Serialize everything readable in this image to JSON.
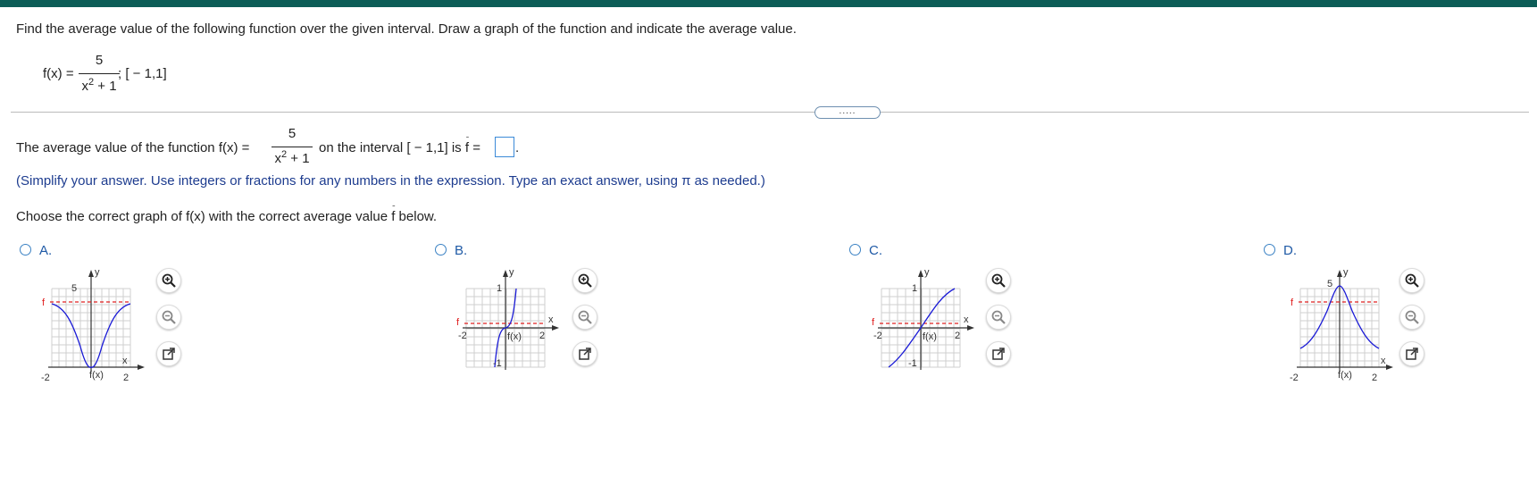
{
  "question": {
    "prompt": "Find the average value of the following function over the given interval. Draw a graph of the function and indicate the average value.",
    "function_lhs": "f(x) =",
    "function_numerator": "5",
    "function_denominator": "x",
    "denominator_exponent": "2",
    "denominator_tail": " + 1",
    "interval": "; [ − 1,1]"
  },
  "more_button": ".....",
  "answer": {
    "lead": "The average value of the function f(x) =",
    "numerator": "5",
    "denominator": "x",
    "exponent": "2",
    "denominator_tail": " + 1",
    "trail": "on the interval [ − 1,1] is",
    "fbar_eq": "f =",
    "end": ".",
    "input_value": ""
  },
  "instruction": "(Simplify your answer. Use integers or fractions for any numbers in the expression. Type an exact answer, using π as needed.)",
  "choose_prompt_a": "Choose the correct graph of f(x) with the correct average value",
  "choose_prompt_b": "f below.",
  "options": [
    {
      "label": "A.",
      "xmin_label": "-2",
      "xmax_label": "2",
      "ytick_label": "5",
      "fn_label": "f(x)",
      "avg_label": "f",
      "x_label": "x",
      "y_label": "y"
    },
    {
      "label": "B.",
      "xmin_label": "-2",
      "xmax_label": "2",
      "ytick_top": "1",
      "ytick_bottom": "-1",
      "fn_label": "f(x)",
      "avg_label": "f",
      "x_label": "x",
      "y_label": "y"
    },
    {
      "label": "C.",
      "xmin_label": "-2",
      "xmax_label": "2",
      "ytick_top": "1",
      "ytick_bottom": "-1",
      "fn_label": "f(x)",
      "avg_label": "f",
      "x_label": "x",
      "y_label": "y"
    },
    {
      "label": "D.",
      "xmin_label": "-2",
      "xmax_label": "2",
      "ytick_label": "5",
      "fn_label": "f(x)",
      "avg_label": "f",
      "x_label": "x",
      "y_label": "y"
    }
  ],
  "colors": {
    "curve": "#1a1ad6",
    "average_line": "#e02020",
    "accent": "#0c5d57",
    "option_label": "#1f5aa6"
  },
  "icons": [
    "zoom-in-icon",
    "zoom-out-icon",
    "popout-icon"
  ]
}
